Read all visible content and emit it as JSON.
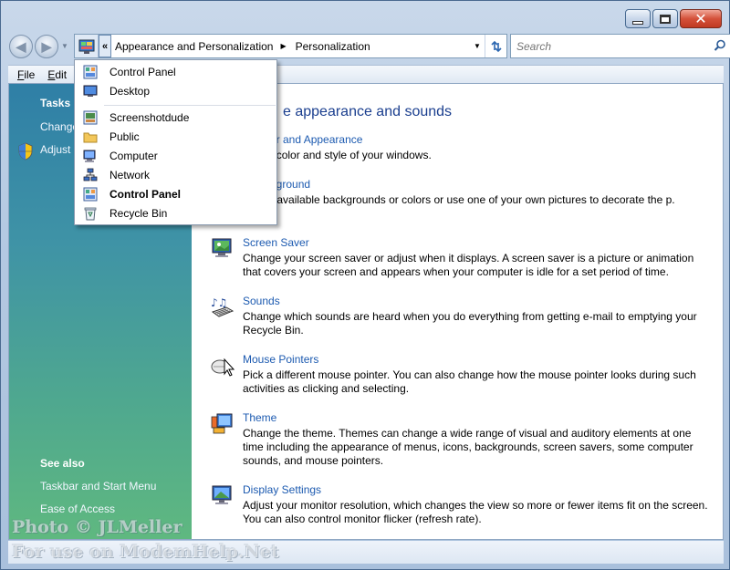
{
  "window": {
    "minimize": "minimize",
    "maximize": "maximize",
    "close": "close"
  },
  "addressbar": {
    "crumbs": [
      "Appearance and Personalization",
      "Personalization"
    ],
    "overflow": "«"
  },
  "search": {
    "placeholder": "Search"
  },
  "menubar": {
    "items": [
      {
        "label": "File",
        "accel": "F",
        "rest": "ile"
      },
      {
        "label": "Edit",
        "accel": "E",
        "rest": "dit"
      }
    ]
  },
  "dropdown": {
    "items": [
      {
        "label": "Control Panel",
        "icon": "control-panel-icon",
        "bold": false
      },
      {
        "label": "Desktop",
        "icon": "desktop-icon",
        "bold": false
      },
      {
        "label": "Screenshotdude",
        "icon": "user-folder-icon",
        "bold": false
      },
      {
        "label": "Public",
        "icon": "folder-icon",
        "bold": false
      },
      {
        "label": "Computer",
        "icon": "computer-icon",
        "bold": false
      },
      {
        "label": "Network",
        "icon": "network-icon",
        "bold": false
      },
      {
        "label": "Control Panel",
        "icon": "control-panel-icon",
        "bold": true
      },
      {
        "label": "Recycle Bin",
        "icon": "recycle-bin-icon",
        "bold": false
      }
    ]
  },
  "sidebar": {
    "tasks_heading": "Tasks",
    "tasks": [
      "Change",
      "Adjust"
    ],
    "see_also_heading": "See also",
    "see_also": [
      "Taskbar and Start Menu",
      "Ease of Access"
    ]
  },
  "main": {
    "title": "e appearance and sounds",
    "items": [
      {
        "link": "w Color and Appearance",
        "desc": "ne the color and style of your windows.",
        "icon": "color-appearance-icon"
      },
      {
        "link": "p Background",
        "desc": "e from available backgrounds or colors or use one of your own pictures to decorate the p.",
        "icon": "desktop-background-icon"
      },
      {
        "link": "Screen Saver",
        "desc": "Change your screen saver or adjust when it displays. A screen saver is a picture or animation that covers your screen and appears when your computer is idle for a set period of time.",
        "icon": "screen-saver-icon"
      },
      {
        "link": "Sounds",
        "desc": "Change which sounds are heard when you do everything from getting e-mail to emptying your Recycle Bin.",
        "icon": "sounds-icon"
      },
      {
        "link": "Mouse Pointers",
        "desc": "Pick a different mouse pointer. You can also change how the mouse pointer looks during such activities as clicking and selecting.",
        "icon": "mouse-pointer-icon"
      },
      {
        "link": "Theme",
        "desc": "Change the theme. Themes can change a wide range of visual and auditory elements at one time including the appearance of menus, icons, backgrounds, screen savers, some computer sounds, and mouse pointers.",
        "icon": "theme-icon"
      },
      {
        "link": "Display Settings",
        "desc": "Adjust your monitor resolution, which changes the view so more or fewer items fit on the screen. You can also control monitor flicker (refresh rate).",
        "icon": "display-settings-icon"
      }
    ]
  },
  "watermark": {
    "line1": "Photo © JLMeller",
    "line2": "For use on ModemHelp.Net"
  }
}
